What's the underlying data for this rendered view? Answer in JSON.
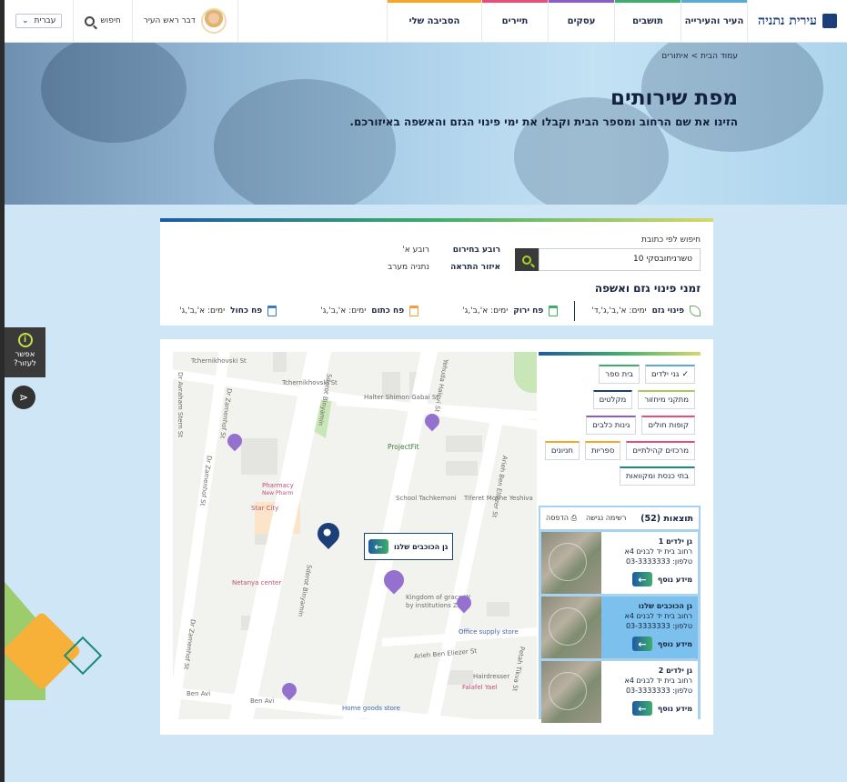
{
  "header": {
    "logo_text": "עירית נתניה",
    "nav": [
      "העיר והעירייה",
      "תושבים",
      "עסקים",
      "תיירים",
      "הסביבה שלי"
    ],
    "mayor_link": "דבר ראש העיר",
    "search_label": "חיפוש",
    "language": "עברית"
  },
  "hero": {
    "breadcrumb": "עמוד הבית > איתורים",
    "title": "מפת שירותים",
    "subtitle": "הזינו את שם הרחוב ומספר הבית וקבלו את ימי פינוי הגזם והאשפה באיזורכם."
  },
  "address": {
    "label": "חיפוש לפי כתובת",
    "value": "טשרניחובסקי 10",
    "quarter_label": "רובע בחירום",
    "quarter_value": "רובע א'",
    "zone_label": "איזור התראה",
    "zone_value": "נתניה מערב"
  },
  "schedule": {
    "title": "זמני פינוי גזם ואשפה",
    "items": [
      {
        "name": "פינוי גזם",
        "days": "ימים: א',ב',ג',ד'",
        "color": "#6aa96a"
      },
      {
        "name": "פח ירוק",
        "days": "ימים: א',ב',ג'",
        "color": "#3fae6a"
      },
      {
        "name": "פח כתום",
        "days": "ימים: א',ב',ג'",
        "color": "#f0a040"
      },
      {
        "name": "פח כחול",
        "days": "ימים: א',ב',ג'",
        "color": "#3a7bbf"
      }
    ]
  },
  "categories": [
    {
      "label": "גני ילדים",
      "checked": true,
      "color": "#5aa9d6"
    },
    {
      "label": "בית ספר",
      "checked": false,
      "color": "#3fae6a"
    },
    {
      "label": "מתקני מיחזור",
      "checked": false,
      "color": "#a7c85a"
    },
    {
      "label": "מקלטים",
      "checked": false,
      "color": "#1c3f7a"
    },
    {
      "label": "קופות חולים",
      "checked": false,
      "color": "#e84e7a"
    },
    {
      "label": "גינות כלבים",
      "checked": false,
      "color": "#8c5cc7"
    },
    {
      "label": "מרכזים קהילתיים",
      "checked": false,
      "color": "#e84e7a"
    },
    {
      "label": "ספריות",
      "checked": false,
      "color": "#f5a623"
    },
    {
      "label": "חניונים",
      "checked": false,
      "color": "#f5a623"
    },
    {
      "label": "בתי כנסת ומקוואות",
      "checked": false,
      "color": "#1a8b7a"
    }
  ],
  "results": {
    "count_label": "תוצאות (52)",
    "accessible_list": "רשימה נגישה",
    "print": "הדפסה",
    "items": [
      {
        "title": "גן ילדים 1",
        "address": "רחוב בית יד לבנים 4א",
        "phone": "טלפון: 03-3333333",
        "more": "מידע נוסף",
        "selected": false
      },
      {
        "title": "גן הכוכבים שלנו",
        "address": "רחוב בית יד לבנים 4א",
        "phone": "טלפון: 03-3333333",
        "more": "מידע נוסף",
        "selected": true
      },
      {
        "title": "גן ילדים 2",
        "address": "רחוב בית יד לבנים 4א",
        "phone": "טלפון: 03-3333333",
        "more": "מידע נוסף",
        "selected": false
      }
    ]
  },
  "map": {
    "popup_title": "גן הכוכבים שלנו",
    "labels": {
      "tchernikhovski": "Tchernikhovski St",
      "tchernikhovski2": "Tchernikhovski St",
      "halter": "Halter Shimon Gabai St",
      "yehuda": "Yehuda Halevi St",
      "sderot1": "Sderot Binyamin",
      "sderot2": "Sderot Binyamin",
      "avraham": "Dr Avraham Stern St",
      "zamenhof1": "Dr Zamenhof St",
      "zamenhof2": "Dr Zamenhof St",
      "zamenhof3": "Dr Zamenhof St",
      "arieh1": "Arieh Ben Eliezer St",
      "arieh2": "Arieh Ben Eliezer St",
      "petah": "Petah Tikva St",
      "benavi1": "Ben Avi",
      "benavi2": "Ben Avi",
      "projectfit": "ProjectFit",
      "school": "School Tachkemoni",
      "tiferet": "Tiferet Moshe Yeshiva",
      "pharmacy": "Pharmacy",
      "newpharm": "New Pharm",
      "starcity": "Star City",
      "netanya": "Netanya center",
      "kingdom": "Kingdom of grace W",
      "kingdom2": "by institutions Zla",
      "office": "Office supply store",
      "hairdresser": "Hairdresser",
      "falafel": "Falafel Yael",
      "homegoods": "Home goods store"
    }
  },
  "widgets": {
    "help_line1": "אפשר",
    "help_line2": "לעזור?",
    "help_icon": "i"
  }
}
